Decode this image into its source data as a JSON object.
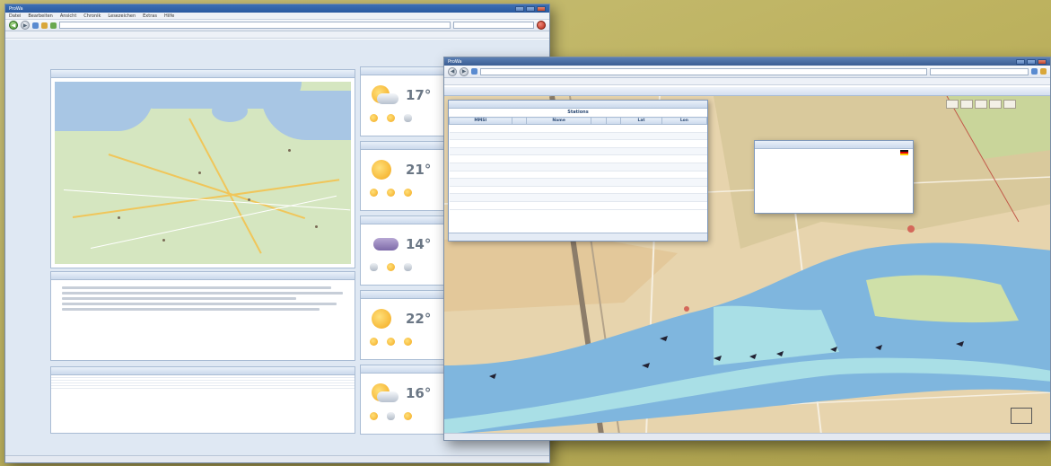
{
  "left_window": {
    "title": "ProWa",
    "menu": [
      "Datei",
      "Bearbeiten",
      "Ansicht",
      "Chronik",
      "Lesezeichen",
      "Extras",
      "Hilfe"
    ],
    "url": "",
    "links": [],
    "panels": {
      "map_title": "",
      "news_title": "",
      "news_items": [
        {
          "date": ""
        },
        {
          "date": ""
        }
      ],
      "table_title": "",
      "table_header": [
        "",
        "",
        "",
        ""
      ],
      "table_rows": [
        [
          "",
          "",
          "",
          ""
        ],
        [
          "",
          "",
          "",
          ""
        ],
        [
          "",
          "",
          "",
          ""
        ],
        [
          "",
          "",
          "",
          ""
        ]
      ]
    },
    "weather": [
      {
        "header": "",
        "temp": "17°",
        "icon": "partly-cloudy-icon"
      },
      {
        "header": "",
        "temp": "21°",
        "icon": "sunny-icon"
      },
      {
        "header": "",
        "temp": "14°",
        "icon": "rain-icon"
      },
      {
        "header": "",
        "temp": "22°",
        "icon": "sunny-icon"
      },
      {
        "header": "",
        "temp": "16°",
        "icon": "partly-cloudy-icon"
      }
    ],
    "status": ""
  },
  "right_window": {
    "title": "ProWa",
    "url": "",
    "search_placeholder": "",
    "toolbar_left": [
      "",
      "",
      ""
    ],
    "toolbar_right": [
      "",
      "",
      ""
    ],
    "ship_table": {
      "caption": "Stations",
      "columns": [
        "MMSI",
        "",
        "Name",
        "",
        "",
        "Lat",
        "Lon"
      ],
      "rows": [
        [
          "",
          "",
          "",
          "",
          "",
          "",
          ""
        ],
        [
          "",
          "",
          "",
          "",
          "",
          "",
          ""
        ],
        [
          "",
          "",
          "",
          "",
          "",
          "",
          ""
        ],
        [
          "",
          "",
          "",
          "",
          "",
          "",
          ""
        ],
        [
          "",
          "",
          "",
          "",
          "",
          "",
          ""
        ],
        [
          "",
          "",
          "",
          "",
          "",
          "",
          ""
        ],
        [
          "",
          "",
          "",
          "",
          "",
          "",
          ""
        ],
        [
          "",
          "",
          "",
          "",
          "",
          "",
          ""
        ],
        [
          "",
          "",
          "",
          "",
          "",
          "",
          ""
        ],
        [
          "",
          "",
          "",
          "",
          "",
          "",
          ""
        ],
        [
          "",
          "",
          "",
          "",
          "",
          "",
          ""
        ]
      ],
      "footer": ""
    },
    "detail_popup": {
      "title": "",
      "rows": [
        {
          "k": "",
          "v": ""
        },
        {
          "k": "",
          "v": ""
        },
        {
          "k": "",
          "v": ""
        },
        {
          "k": "",
          "v": ""
        },
        {
          "k": "",
          "v": ""
        },
        {
          "k": "",
          "v": ""
        }
      ]
    },
    "logo_text": "",
    "status": ""
  },
  "colors": {
    "background": "#bdb25f",
    "chrome_blue": "#2a59a0",
    "water": "#7fb8e0",
    "fairway": "#a9e0e8",
    "land": "#e8d7b3"
  }
}
